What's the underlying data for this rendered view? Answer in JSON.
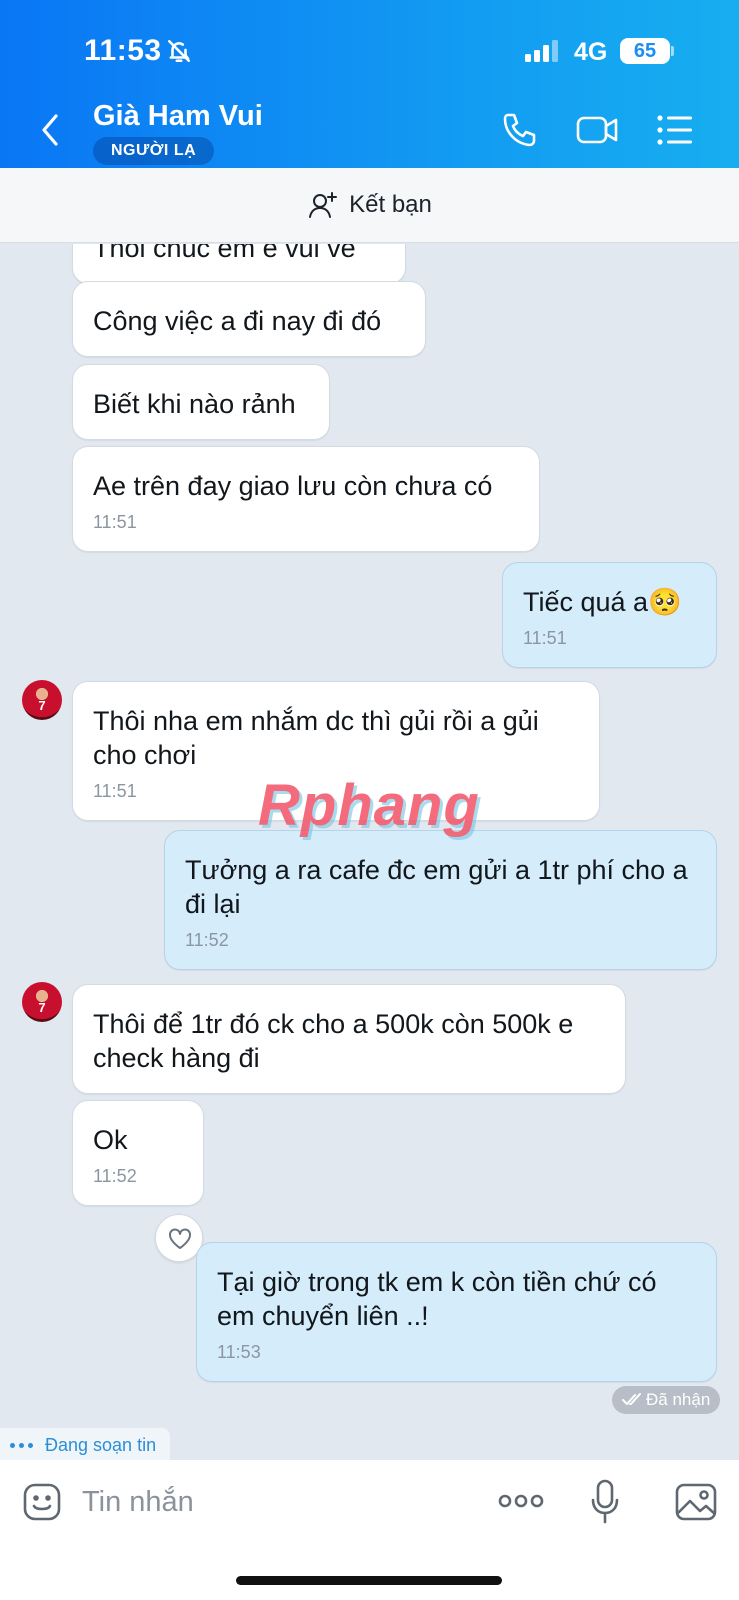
{
  "status": {
    "time": "11:53",
    "network": "4G",
    "battery": "65"
  },
  "header": {
    "name": "Già Ham Vui",
    "badge": "NGƯỜI LẠ"
  },
  "friend_bar": {
    "label": "Kết bạn"
  },
  "messages": [
    {
      "text": "Thôi chúc em e vui vẻ",
      "time": ""
    },
    {
      "text": "Công việc a đi nay đi đó",
      "time": ""
    },
    {
      "text": "Biết khi nào rảnh",
      "time": ""
    },
    {
      "text": "Ae trên đay giao lưu còn chưa có",
      "time": "11:51"
    },
    {
      "text": "Tiếc quá a🥺",
      "time": "11:51"
    },
    {
      "text": "Thôi nha em nhắm dc thì gủi rồi a gủi cho chơi",
      "time": "11:51"
    },
    {
      "text": "Tưởng a ra cafe đc em gửi a 1tr phí cho a đi lại",
      "time": "11:52"
    },
    {
      "text": "Thôi để 1tr đó ck cho a 500k còn 500k e check hàng đi",
      "time": ""
    },
    {
      "text": "Ok",
      "time": "11:52"
    },
    {
      "text": "Tại giờ trong tk em k còn tiền chứ có em chuyển liên ..!",
      "time": "11:53"
    }
  ],
  "avatar_label": "7",
  "watermark": "Rphang",
  "received_status": "Đã nhận",
  "typing_text": "Đang soạn tin",
  "composer": {
    "placeholder": "Tin nhắn"
  },
  "colors": {
    "header_start": "#0a76f5",
    "header_end": "#17aef0",
    "sent_bubble": "#d5ecfb",
    "received_bubble": "#ffffff",
    "chat_bg": "#e2e8ef"
  }
}
